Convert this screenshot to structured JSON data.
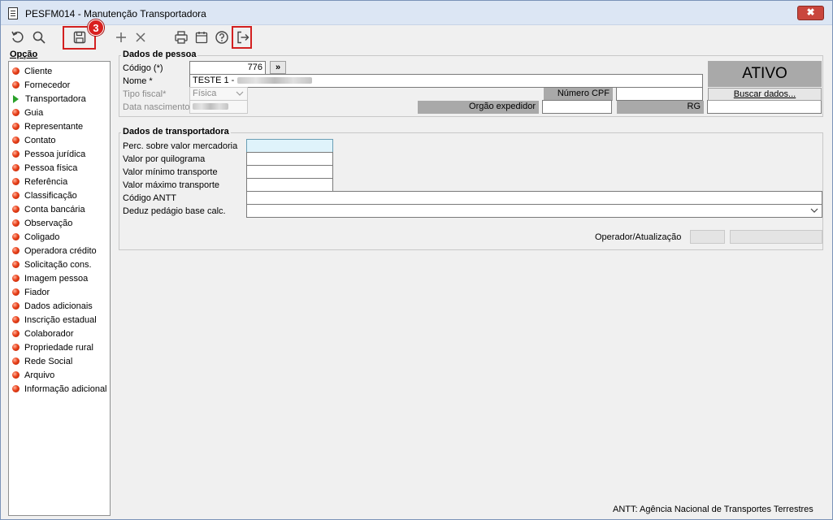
{
  "window": {
    "title": "PESFM014 - Manutenção Transportadora",
    "close_label": "✖"
  },
  "toolbar": {
    "icons": [
      "undo-icon",
      "search-icon",
      "save-icon",
      "add-icon",
      "delete-icon",
      "print-icon",
      "calendar-icon",
      "help-icon",
      "exit-icon"
    ],
    "badge": "3"
  },
  "sidebar": {
    "header": "Opção",
    "items": [
      {
        "label": "Cliente"
      },
      {
        "label": "Fornecedor"
      },
      {
        "label": "Transportadora",
        "active": true
      },
      {
        "label": "Guia"
      },
      {
        "label": "Representante"
      },
      {
        "label": "Contato"
      },
      {
        "label": "Pessoa jurídica"
      },
      {
        "label": "Pessoa física"
      },
      {
        "label": "Referência"
      },
      {
        "label": "Classificação"
      },
      {
        "label": "Conta bancária"
      },
      {
        "label": "Observação"
      },
      {
        "label": "Coligado"
      },
      {
        "label": "Operadora crédito"
      },
      {
        "label": "Solicitação cons."
      },
      {
        "label": "Imagem pessoa"
      },
      {
        "label": "Fiador"
      },
      {
        "label": "Dados adicionais"
      },
      {
        "label": "Inscrição estadual"
      },
      {
        "label": "Colaborador"
      },
      {
        "label": "Propriedade rural"
      },
      {
        "label": "Rede Social"
      },
      {
        "label": "Arquivo"
      },
      {
        "label": "Informação adicional"
      }
    ]
  },
  "pessoa": {
    "legend": "Dados de pessoa",
    "codigo_label": "Código (*)",
    "codigo_value": "776",
    "lookup_label": "»",
    "nome_label": "Nome *",
    "nome_value": "TESTE 1 -",
    "tipo_label": "Tipo fiscal*",
    "tipo_value": "Física",
    "data_nasc_label": "Data nascimento",
    "cpf_label": "Número CPF",
    "cpf_value": "",
    "orgao_label": "Orgão expedidor",
    "orgao_value": "",
    "rg_label": "RG",
    "rg_value": "",
    "status": "ATIVO",
    "buscar_label": "Buscar dados..."
  },
  "transportadora": {
    "legend": "Dados de transportadora",
    "perc_label": "Perc. sobre valor mercadoria",
    "valor_kg_label": "Valor por quilograma",
    "valor_min_label": "Valor mínimo transporte",
    "valor_max_label": "Valor máximo transporte",
    "antt_label": "Código ANTT",
    "deduz_label": "Deduz pedágio base calc.",
    "operador_label": "Operador/Atualização"
  },
  "footer": {
    "note": "ANTT: Agência Nacional de Transportes Terrestres"
  }
}
